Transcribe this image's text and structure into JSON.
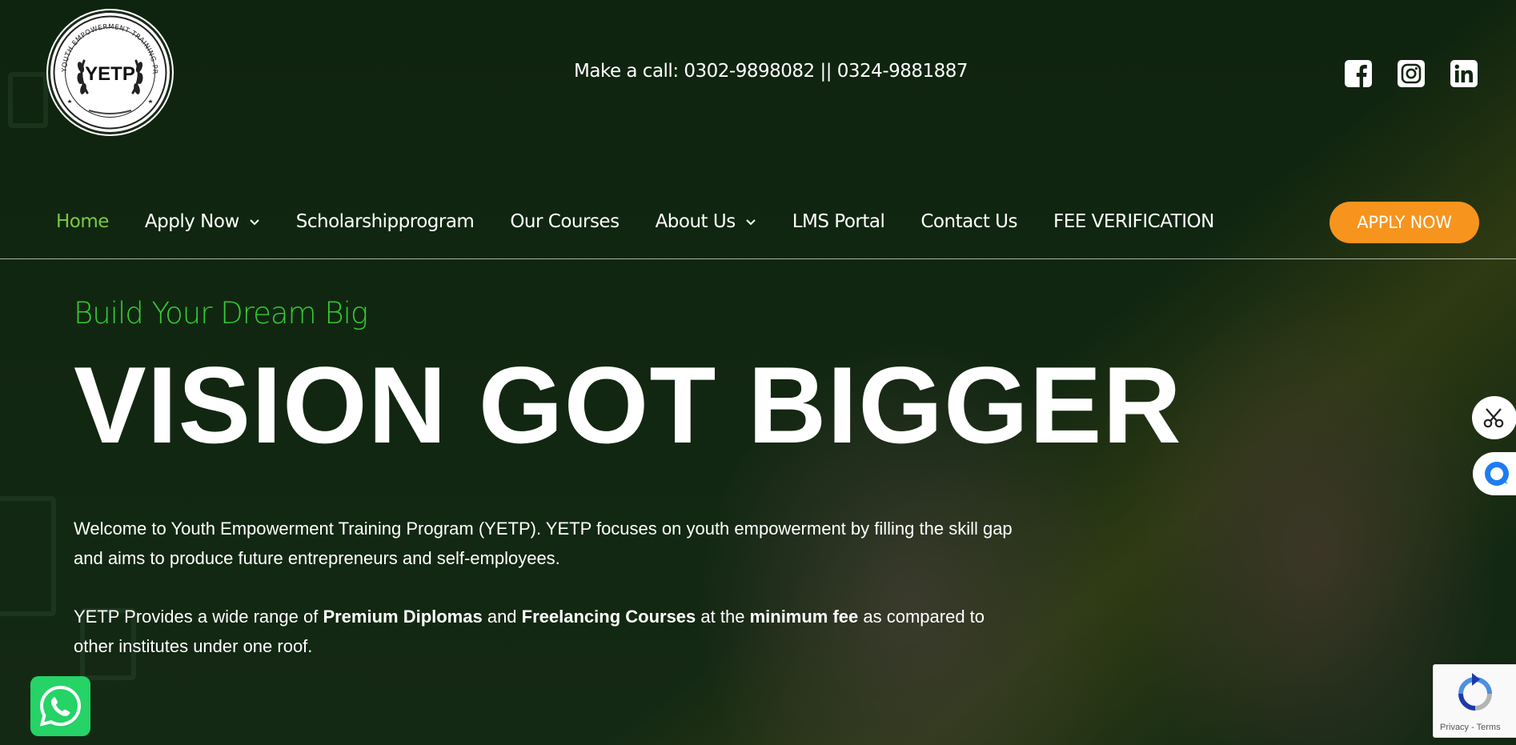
{
  "header": {
    "logo_text": "YETP",
    "logo_ring_text": "YOUTH EMPOWERMENT TRAINING PROGRAM",
    "call_label": "Make a call:",
    "phone_1": "0302-9898082",
    "separator": "||",
    "phone_2": "0324-9881887",
    "socials": [
      "facebook-icon",
      "instagram-icon",
      "linkedin-icon"
    ]
  },
  "nav": {
    "items": [
      {
        "label": "Home",
        "active": true
      },
      {
        "label": "Apply Now",
        "dropdown": true
      },
      {
        "label": "Scholarshipprogram"
      },
      {
        "label": "Our Courses"
      },
      {
        "label": "About Us",
        "dropdown": true
      },
      {
        "label": "LMS Portal"
      },
      {
        "label": "Contact Us"
      },
      {
        "label": "FEE VERIFICATION"
      }
    ],
    "cta_label": "APPLY NOW"
  },
  "hero": {
    "tagline": "Build Your Dream Big",
    "headline": "VISION GOT BIGGER",
    "para1": "Welcome to Youth Empowerment Training Program (YETP). YETP focuses on youth empowerment by filling the skill gap and aims to produce future entrepreneurs and self-employees.",
    "para2": {
      "p1": "YETP Provides a wide range of ",
      "b1": "Premium Diplomas",
      "p2": " and ",
      "b2": "Freelancing Courses",
      "p3": " at the ",
      "b3": "minimum fee",
      "p4": " as compared to other institutes under one roof."
    }
  },
  "widgets": {
    "recaptcha_privacy": "Privacy",
    "recaptcha_sep": " - ",
    "recaptcha_terms": "Terms"
  },
  "colors": {
    "accent_green": "#7ac943",
    "tagline_green": "#33cc33",
    "cta_orange": "#f7941d",
    "whatsapp_green": "#25d366"
  }
}
